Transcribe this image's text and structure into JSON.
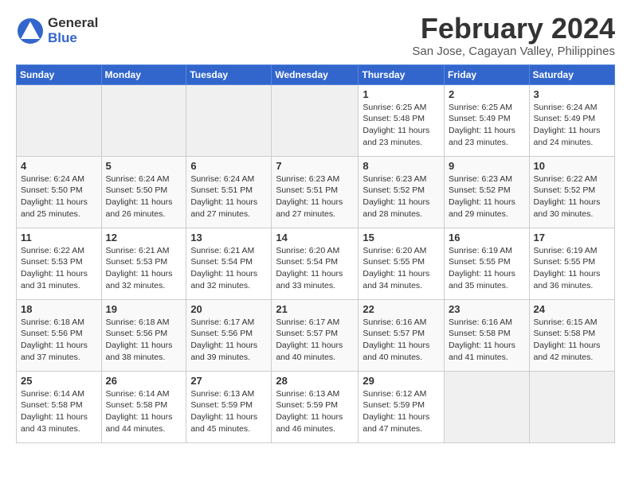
{
  "logo": {
    "general": "General",
    "blue": "Blue"
  },
  "title": "February 2024",
  "location": "San Jose, Cagayan Valley, Philippines",
  "days_of_week": [
    "Sunday",
    "Monday",
    "Tuesday",
    "Wednesday",
    "Thursday",
    "Friday",
    "Saturday"
  ],
  "weeks": [
    [
      {
        "day": "",
        "info": ""
      },
      {
        "day": "",
        "info": ""
      },
      {
        "day": "",
        "info": ""
      },
      {
        "day": "",
        "info": ""
      },
      {
        "day": "1",
        "info": "Sunrise: 6:25 AM\nSunset: 5:48 PM\nDaylight: 11 hours and 23 minutes."
      },
      {
        "day": "2",
        "info": "Sunrise: 6:25 AM\nSunset: 5:49 PM\nDaylight: 11 hours and 23 minutes."
      },
      {
        "day": "3",
        "info": "Sunrise: 6:24 AM\nSunset: 5:49 PM\nDaylight: 11 hours and 24 minutes."
      }
    ],
    [
      {
        "day": "4",
        "info": "Sunrise: 6:24 AM\nSunset: 5:50 PM\nDaylight: 11 hours and 25 minutes."
      },
      {
        "day": "5",
        "info": "Sunrise: 6:24 AM\nSunset: 5:50 PM\nDaylight: 11 hours and 26 minutes."
      },
      {
        "day": "6",
        "info": "Sunrise: 6:24 AM\nSunset: 5:51 PM\nDaylight: 11 hours and 27 minutes."
      },
      {
        "day": "7",
        "info": "Sunrise: 6:23 AM\nSunset: 5:51 PM\nDaylight: 11 hours and 27 minutes."
      },
      {
        "day": "8",
        "info": "Sunrise: 6:23 AM\nSunset: 5:52 PM\nDaylight: 11 hours and 28 minutes."
      },
      {
        "day": "9",
        "info": "Sunrise: 6:23 AM\nSunset: 5:52 PM\nDaylight: 11 hours and 29 minutes."
      },
      {
        "day": "10",
        "info": "Sunrise: 6:22 AM\nSunset: 5:52 PM\nDaylight: 11 hours and 30 minutes."
      }
    ],
    [
      {
        "day": "11",
        "info": "Sunrise: 6:22 AM\nSunset: 5:53 PM\nDaylight: 11 hours and 31 minutes."
      },
      {
        "day": "12",
        "info": "Sunrise: 6:21 AM\nSunset: 5:53 PM\nDaylight: 11 hours and 32 minutes."
      },
      {
        "day": "13",
        "info": "Sunrise: 6:21 AM\nSunset: 5:54 PM\nDaylight: 11 hours and 32 minutes."
      },
      {
        "day": "14",
        "info": "Sunrise: 6:20 AM\nSunset: 5:54 PM\nDaylight: 11 hours and 33 minutes."
      },
      {
        "day": "15",
        "info": "Sunrise: 6:20 AM\nSunset: 5:55 PM\nDaylight: 11 hours and 34 minutes."
      },
      {
        "day": "16",
        "info": "Sunrise: 6:19 AM\nSunset: 5:55 PM\nDaylight: 11 hours and 35 minutes."
      },
      {
        "day": "17",
        "info": "Sunrise: 6:19 AM\nSunset: 5:55 PM\nDaylight: 11 hours and 36 minutes."
      }
    ],
    [
      {
        "day": "18",
        "info": "Sunrise: 6:18 AM\nSunset: 5:56 PM\nDaylight: 11 hours and 37 minutes."
      },
      {
        "day": "19",
        "info": "Sunrise: 6:18 AM\nSunset: 5:56 PM\nDaylight: 11 hours and 38 minutes."
      },
      {
        "day": "20",
        "info": "Sunrise: 6:17 AM\nSunset: 5:56 PM\nDaylight: 11 hours and 39 minutes."
      },
      {
        "day": "21",
        "info": "Sunrise: 6:17 AM\nSunset: 5:57 PM\nDaylight: 11 hours and 40 minutes."
      },
      {
        "day": "22",
        "info": "Sunrise: 6:16 AM\nSunset: 5:57 PM\nDaylight: 11 hours and 40 minutes."
      },
      {
        "day": "23",
        "info": "Sunrise: 6:16 AM\nSunset: 5:58 PM\nDaylight: 11 hours and 41 minutes."
      },
      {
        "day": "24",
        "info": "Sunrise: 6:15 AM\nSunset: 5:58 PM\nDaylight: 11 hours and 42 minutes."
      }
    ],
    [
      {
        "day": "25",
        "info": "Sunrise: 6:14 AM\nSunset: 5:58 PM\nDaylight: 11 hours and 43 minutes."
      },
      {
        "day": "26",
        "info": "Sunrise: 6:14 AM\nSunset: 5:58 PM\nDaylight: 11 hours and 44 minutes."
      },
      {
        "day": "27",
        "info": "Sunrise: 6:13 AM\nSunset: 5:59 PM\nDaylight: 11 hours and 45 minutes."
      },
      {
        "day": "28",
        "info": "Sunrise: 6:13 AM\nSunset: 5:59 PM\nDaylight: 11 hours and 46 minutes."
      },
      {
        "day": "29",
        "info": "Sunrise: 6:12 AM\nSunset: 5:59 PM\nDaylight: 11 hours and 47 minutes."
      },
      {
        "day": "",
        "info": ""
      },
      {
        "day": "",
        "info": ""
      }
    ]
  ]
}
